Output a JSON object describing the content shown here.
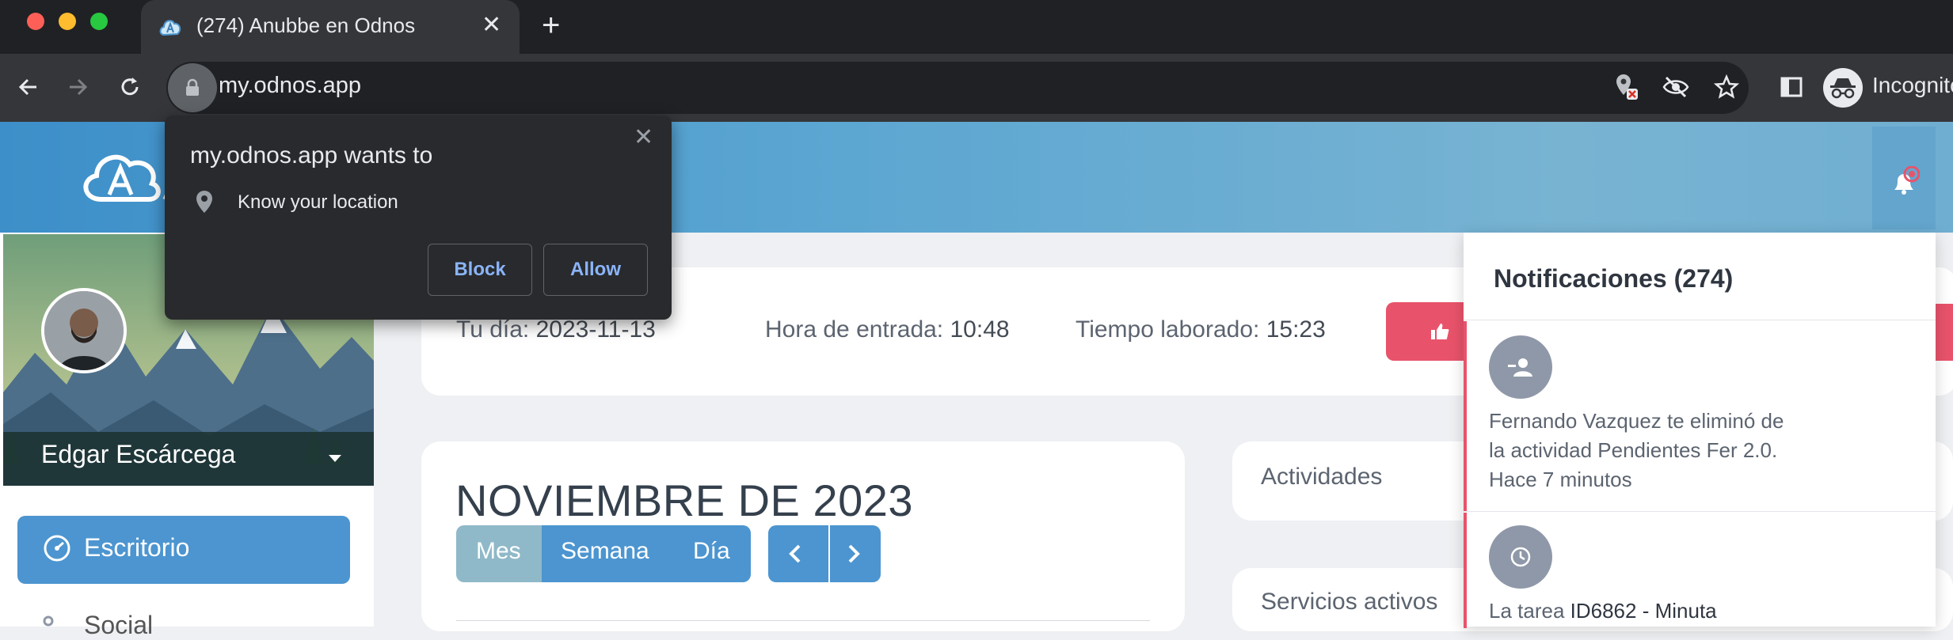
{
  "browser": {
    "tab_title": "(274) Anubbe en Odnos",
    "url": "my.odnos.app",
    "incognito_label": "Incognito"
  },
  "permission_popup": {
    "title": "my.odnos.app wants to",
    "item": "Know your location",
    "block_label": "Block",
    "allow_label": "Allow"
  },
  "sidebar": {
    "user_name": "Edgar Escárcega",
    "items": [
      {
        "label": "Escritorio"
      },
      {
        "label": "Social"
      }
    ]
  },
  "day_info": {
    "day_label": "Tu día:",
    "day_value": "2023-11-13",
    "entry_label": "Hora de entrada:",
    "entry_value": "10:48",
    "worked_label": "Tiempo laborado:",
    "worked_value": "15:23"
  },
  "calendar": {
    "title": "NOVIEMBRE DE 2023",
    "view_month": "Mes",
    "view_week": "Semana",
    "view_day": "Día"
  },
  "cards": {
    "activities": "Actividades",
    "services": "Servicios activos"
  },
  "notifications": {
    "title": "Notificaciones (274)",
    "items": [
      {
        "line1": "Fernando Vazquez te eliminó de",
        "line2": "la actividad Pendientes Fer 2.0.",
        "time": "Hace 7 minutos",
        "icon": "user-minus-icon"
      },
      {
        "line1_prefix": "La tarea",
        "line1_bold": "ID6862 - Minuta",
        "icon": "clock-icon"
      }
    ]
  },
  "colors": {
    "chrome_dark": "#202124",
    "toolbar": "#35363a",
    "primary_blue": "#4c95d0",
    "accent_red": "#e8536b",
    "month_active": "#8fb9c9"
  }
}
